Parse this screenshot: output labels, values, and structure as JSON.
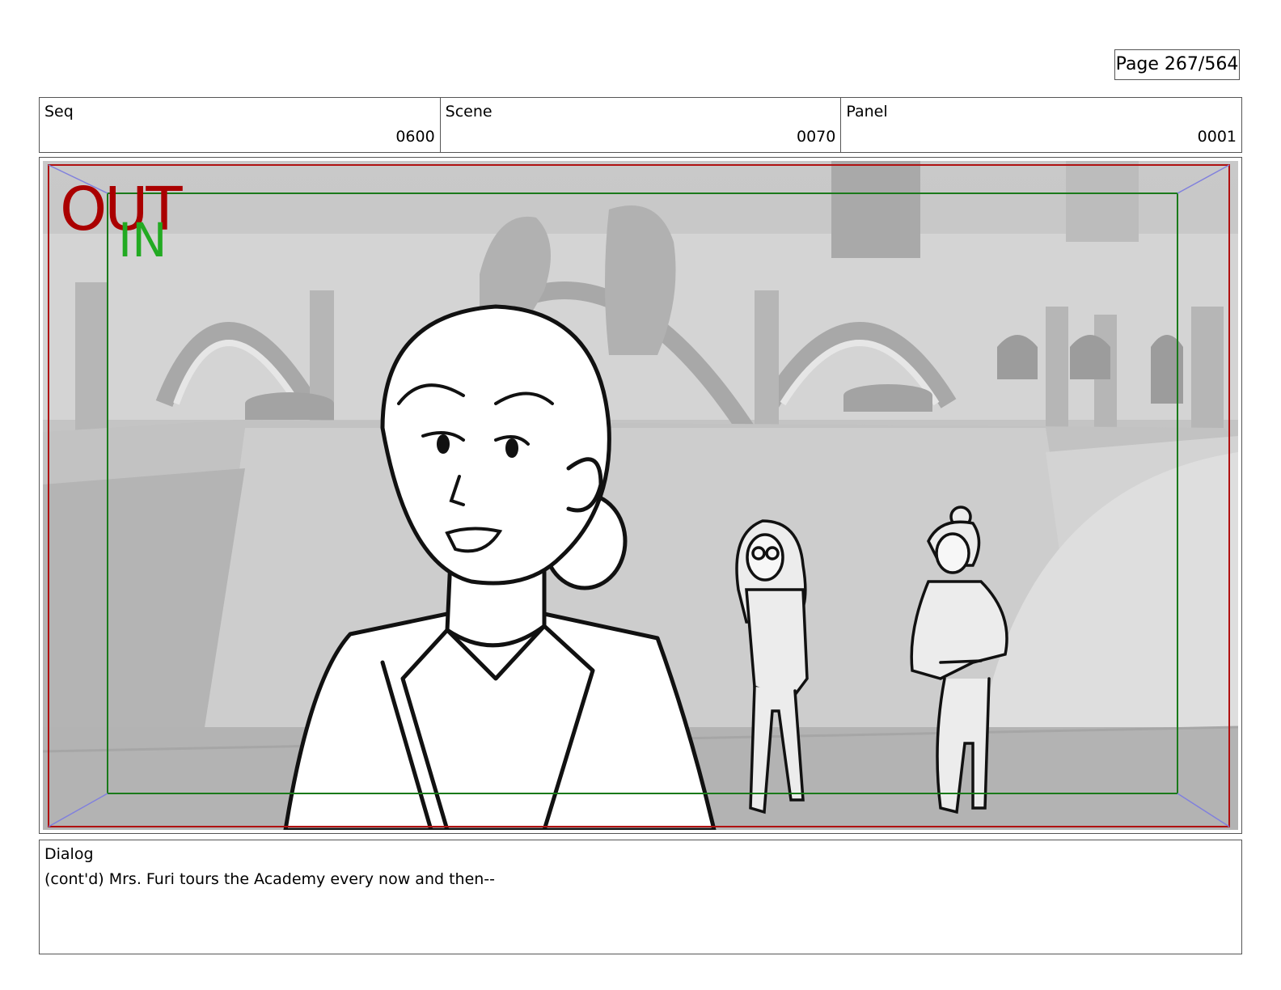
{
  "page": {
    "label": "Page 267/564"
  },
  "info": {
    "seq_label": "Seq",
    "seq_value": "0600",
    "scene_label": "Scene",
    "scene_value": "0070",
    "panel_label": "Panel",
    "panel_value": "0001"
  },
  "frame_guides": {
    "outer_label": "OUT",
    "inner_label": "IN",
    "outer_color": "#aa0000",
    "inner_color": "#22aa22"
  },
  "dialog": {
    "label": "Dialog",
    "text": "(cont'd) Mrs. Furi tours the Academy every now and then--"
  }
}
